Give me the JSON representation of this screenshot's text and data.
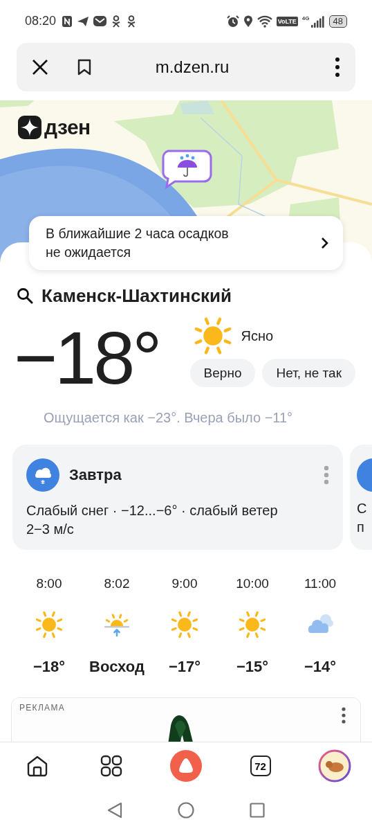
{
  "status_bar": {
    "time": "08:20",
    "volte": "VoLTE",
    "network": "4G",
    "battery": "48"
  },
  "browser": {
    "url": "m.dzen.ru"
  },
  "header": {
    "logo": "дзен"
  },
  "precip_notice": {
    "text": "В ближайшие 2 часа осадков не ожидается"
  },
  "location": "Каменск-Шахтинский",
  "current": {
    "temperature": "−18°",
    "condition": "Ясно",
    "feels_like": "Ощущается как −23°. Вчера было −11°"
  },
  "feedback_buttons": [
    "Верно",
    "Нет, не так"
  ],
  "forecast_card": {
    "title": "Завтра",
    "text": "Слабый снег · −12...−6° · слабый ветер 2−3 м/с"
  },
  "next_card": {
    "lines": [
      "С",
      "п"
    ]
  },
  "hourly": [
    {
      "time": "8:00",
      "kind": "sun",
      "value": "−18°"
    },
    {
      "time": "8:02",
      "kind": "sunrise",
      "value": "Восход"
    },
    {
      "time": "9:00",
      "kind": "sun",
      "value": "−17°"
    },
    {
      "time": "10:00",
      "kind": "sun",
      "value": "−15°"
    },
    {
      "time": "11:00",
      "kind": "cloud",
      "value": "−14°"
    }
  ],
  "ad": {
    "label": "РЕКЛАМА"
  },
  "bottom_nav": [
    {
      "kind": "home"
    },
    {
      "kind": "grid"
    },
    {
      "kind": "assistant"
    },
    {
      "kind": "tabs",
      "label": "72"
    },
    {
      "kind": "avatar"
    }
  ]
}
